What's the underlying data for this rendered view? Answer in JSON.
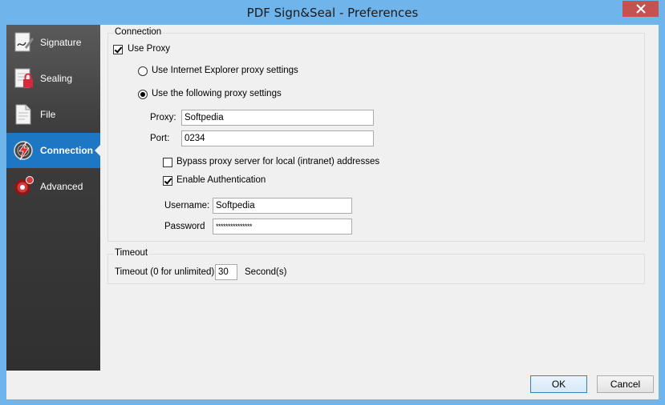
{
  "window": {
    "title": "PDF Sign&Seal - Preferences"
  },
  "sidebar": {
    "items": [
      {
        "label": "Signature",
        "icon": "signature-icon"
      },
      {
        "label": "Sealing",
        "icon": "sealing-icon"
      },
      {
        "label": "File",
        "icon": "file-icon"
      },
      {
        "label": "Connection",
        "icon": "connection-icon",
        "active": true
      },
      {
        "label": "Advanced",
        "icon": "advanced-icon"
      }
    ]
  },
  "connection": {
    "group_label": "Connection",
    "use_proxy_label": "Use Proxy",
    "use_proxy_checked": true,
    "ie_proxy_label": "Use Internet Explorer proxy settings",
    "following_proxy_label": "Use the following proxy settings",
    "selected_option": "following",
    "proxy_label": "Proxy:",
    "proxy_value": "Softpedia",
    "port_label": "Port:",
    "port_value": "0234",
    "bypass_label": "Bypass proxy server for local (intranet) addresses",
    "bypass_checked": false,
    "auth_label": "Enable Authentication",
    "auth_checked": true,
    "username_label": "Username:",
    "username_value": "Softpedia",
    "password_label": "Password",
    "password_value": "***************"
  },
  "timeout": {
    "group_label": "Timeout",
    "label": "Timeout (0 for unlimited):",
    "value": "30",
    "unit": "Second(s)"
  },
  "buttons": {
    "ok": "OK",
    "cancel": "Cancel"
  },
  "colors": {
    "accent": "#1e77c4",
    "titlebar": "#6fb5ec",
    "close": "#c75050"
  }
}
